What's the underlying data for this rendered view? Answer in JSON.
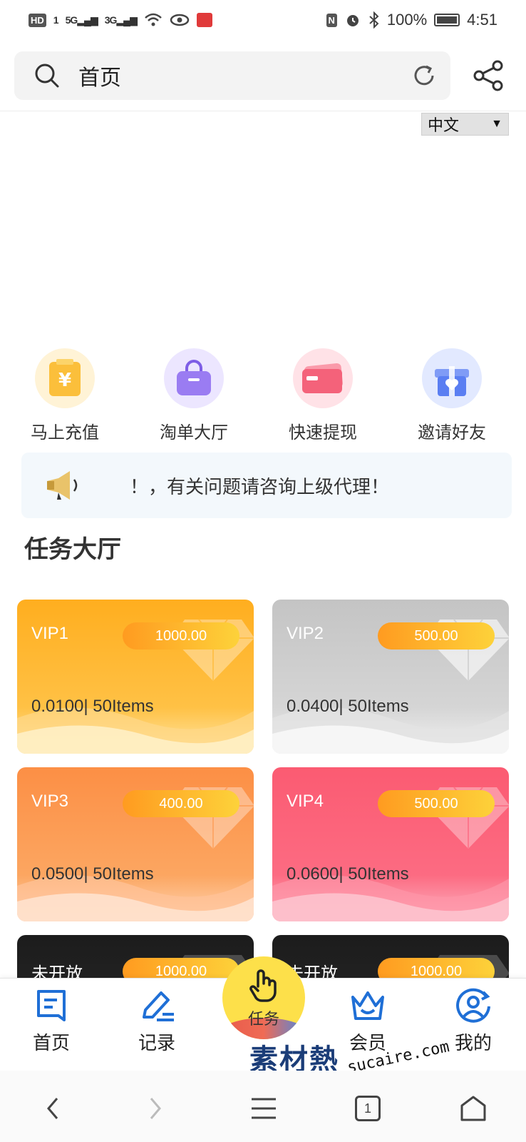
{
  "status_bar": {
    "left_badge": "HD",
    "sim_num": "1",
    "net_5g": "5G",
    "net_3g": "3G",
    "nfc": "N",
    "battery_text": "100%",
    "time": "4:51"
  },
  "browser": {
    "address_text": "首页"
  },
  "language": {
    "selected": "中文",
    "arrow": "▼"
  },
  "quick_actions": [
    {
      "label": "马上充值",
      "icon": "recharge-icon",
      "color": "#fbbf3b"
    },
    {
      "label": "淘单大厅",
      "icon": "bag-icon",
      "color": "#9a7cf2"
    },
    {
      "label": "快速提现",
      "icon": "card-icon",
      "color": "#f4627a"
    },
    {
      "label": "邀请好友",
      "icon": "gift-icon",
      "color": "#5a7ef2"
    }
  ],
  "notice": {
    "text": "！，有关问题请咨询上级代理！"
  },
  "section": {
    "title": "任务大厅"
  },
  "vip_cards": [
    {
      "name": "VIP1",
      "price": "1000.00",
      "info": "0.0100| 50Items"
    },
    {
      "name": "VIP2",
      "price": "500.00",
      "info": "0.0400| 50Items"
    },
    {
      "name": "VIP3",
      "price": "400.00",
      "info": "0.0500| 50Items"
    },
    {
      "name": "VIP4",
      "price": "500.00",
      "info": "0.0600| 50Items"
    },
    {
      "name": "未开放",
      "price": "1000.00"
    },
    {
      "name": "未开放",
      "price": "1000.00"
    }
  ],
  "tabs": [
    {
      "label": "首页",
      "icon": "home-doc-icon"
    },
    {
      "label": "记录",
      "icon": "pen-icon"
    },
    {
      "label": "任务",
      "icon": "tap-hand-icon"
    },
    {
      "label": "会员",
      "icon": "crown-icon"
    },
    {
      "label": "我的",
      "icon": "user-icon"
    }
  ],
  "watermark": {
    "cn": "素材熱",
    "en": "sucaire.com"
  },
  "nav": {
    "tab_count": "1"
  },
  "colors": {
    "tab_accent": "#1f6fd6",
    "center_tab": "#fde04a",
    "price_pill_start": "#ff9b20",
    "price_pill_end": "#fdd23a"
  }
}
